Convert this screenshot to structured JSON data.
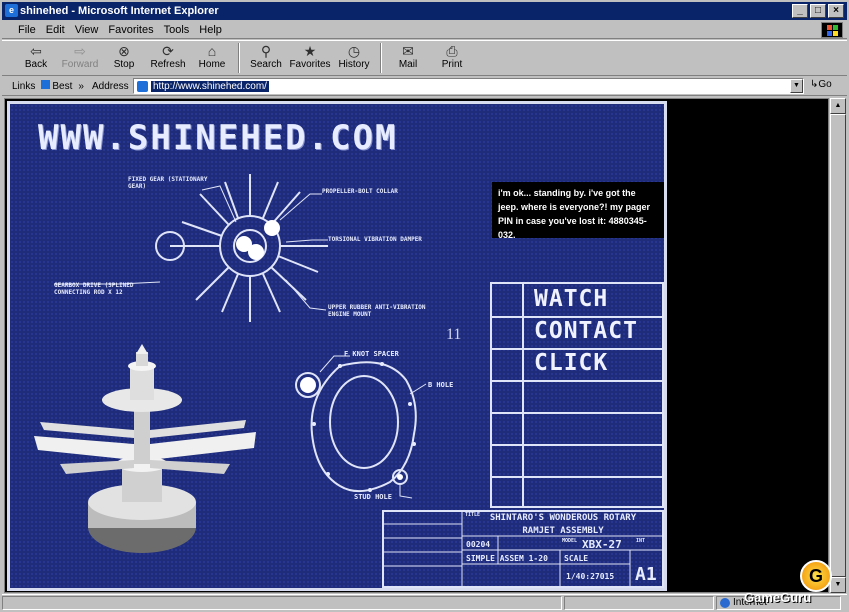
{
  "window": {
    "title": "shinehed - Microsoft Internet Explorer",
    "controls": [
      "_",
      "□",
      "×"
    ]
  },
  "menu": [
    "File",
    "Edit",
    "View",
    "Favorites",
    "Tools",
    "Help"
  ],
  "toolbar": [
    {
      "label": "Back",
      "icon": "back-arrow-icon",
      "enabled": true
    },
    {
      "label": "Forward",
      "icon": "forward-arrow-icon",
      "enabled": false
    },
    {
      "label": "Stop",
      "icon": "stop-icon",
      "enabled": true
    },
    {
      "label": "Refresh",
      "icon": "refresh-icon",
      "enabled": true
    },
    {
      "label": "Home",
      "icon": "home-icon",
      "enabled": true
    },
    {
      "label": "Search",
      "icon": "search-icon",
      "enabled": true
    },
    {
      "label": "Favorites",
      "icon": "favorites-icon",
      "enabled": true
    },
    {
      "label": "History",
      "icon": "history-icon",
      "enabled": true
    },
    {
      "label": "Mail",
      "icon": "mail-icon",
      "enabled": true
    },
    {
      "label": "Print",
      "icon": "print-icon",
      "enabled": true
    }
  ],
  "address_bar": {
    "links_label": "Links",
    "best_label": "Best",
    "more": "»",
    "address_label": "Address",
    "url": "http://www.shinehed.com/",
    "go_label": "Go"
  },
  "page": {
    "logo": "WWW.SHINEHED.COM",
    "message": "i'm ok... standing by. i've got the jeep. where is everyone?! my pager PIN in case you've lost it: 4880345-032.",
    "number": "11",
    "nav": [
      "WATCH",
      "CONTACT",
      "CLICK"
    ],
    "labels": {
      "fixed_gear": "FIXED GEAR (STATIONARY GEAR)",
      "propeller": "PROPELLER-BOLT COLLAR",
      "torsional": "TORSIONAL VIBRATION DAMPER",
      "gearbox": "GEARBOX DRIVE (SPLINED CONNECTING ROD X 12",
      "upper_rubber": "UPPER RUBBER ANTI-VIBRATION ENGINE MOUNT",
      "f_knot": "F KNOT SPACER",
      "b_hole": "B HOLE",
      "stud_hole": "STUD HOLE"
    },
    "title_block": {
      "title_small": "TITLE",
      "title": "SHINTARO'S WONDEROUS ROTARY RAMJET ASSEMBLY",
      "part_no": "00204",
      "model_label": "MODEL",
      "model": "XBX-27",
      "rev": "INT",
      "assembly": "SIMPLE ASSEM 1-20",
      "scale_label": "SCALE",
      "scale": "1/40:27015",
      "sheet": "A1"
    }
  },
  "status": {
    "zone": "Internet",
    "watermark": "GameGuru"
  }
}
